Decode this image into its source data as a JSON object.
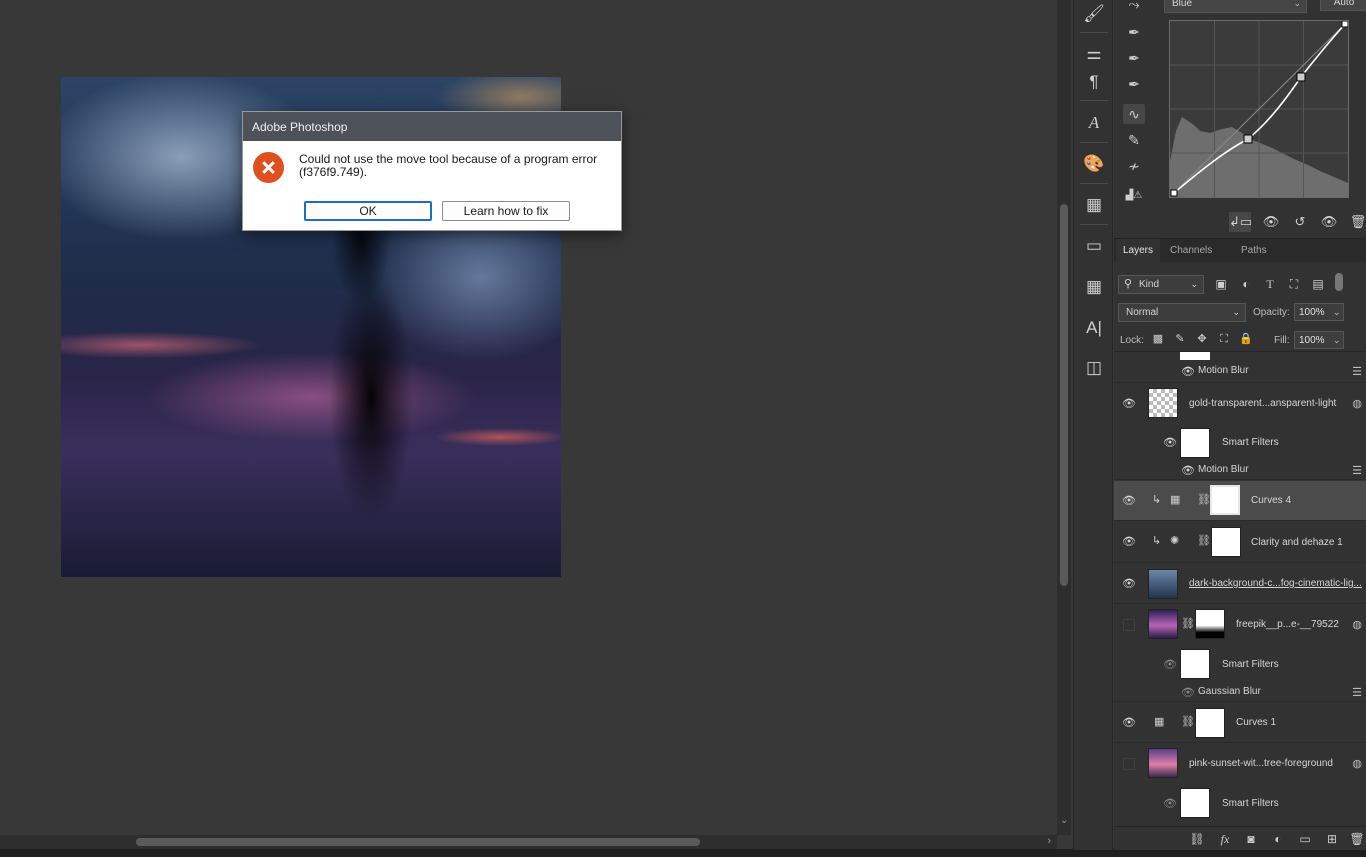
{
  "dialog": {
    "title": "Adobe Photoshop",
    "message": "Could not use the move tool because of a program error (f376f9.749).",
    "ok_label": "OK",
    "learn_label": "Learn how to fix"
  },
  "curves": {
    "channel": "Blue",
    "auto_label": "Auto"
  },
  "tabs": [
    "Layers",
    "Channels",
    "Paths"
  ],
  "layers_panel": {
    "kind_label": "Kind",
    "blend_mode": "Normal",
    "opacity_label": "Opacity:",
    "opacity_value": "100%",
    "lock_label": "Lock:",
    "fill_label": "Fill:",
    "fill_value": "100%"
  },
  "layers": {
    "row0_filter": "Motion Blur",
    "row1_name": "gold-transparent...ansparent-light",
    "row1_smart": "Smart Filters",
    "row1_filter": "Motion Blur",
    "row2_name": "Curves 4",
    "row3_name": "Clarity and dehaze 1",
    "row4_name": "dark-background-c...fog-cinematic-lig...",
    "row5_name": "freepik__p...e-__79522",
    "row5_smart": "Smart Filters",
    "row5_filter": "Gaussian Blur",
    "row6_name": "Curves 1",
    "row7_name": "pink-sunset-wit...tree-foreground",
    "row7_smart": "Smart Filters"
  }
}
